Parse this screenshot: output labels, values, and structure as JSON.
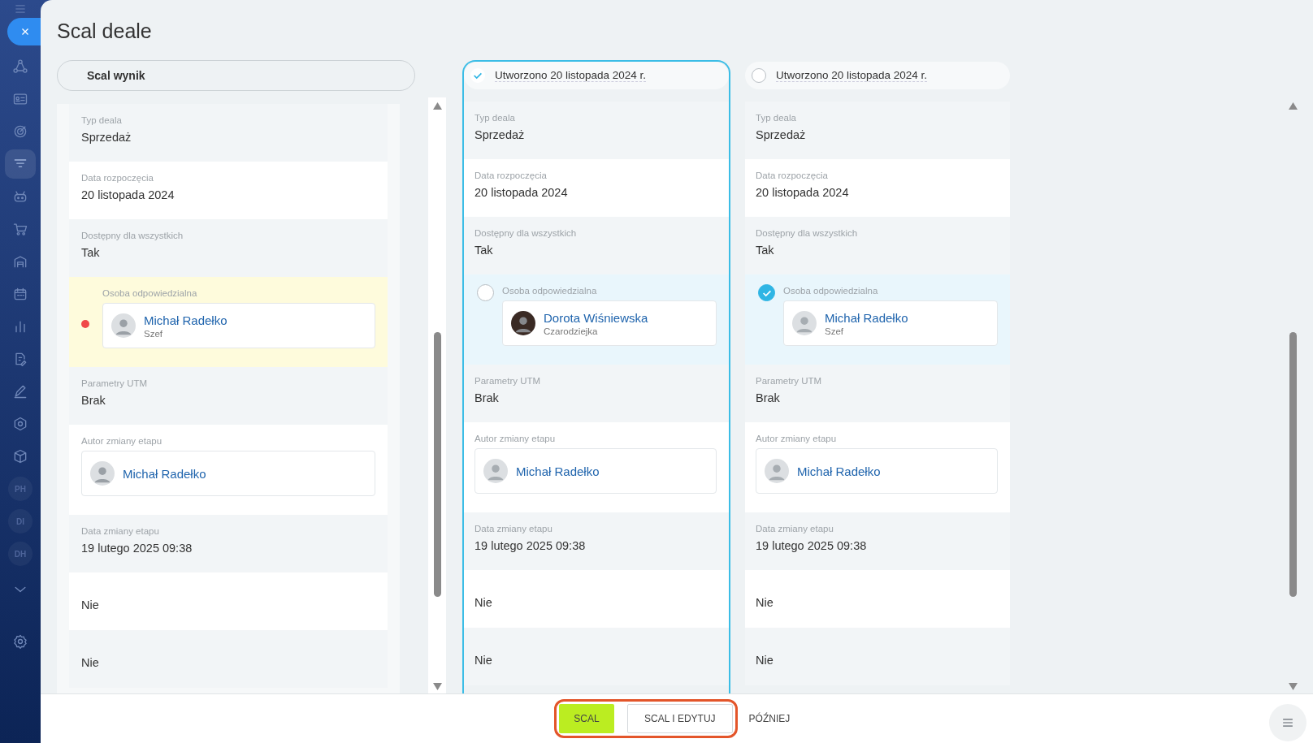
{
  "sidebar": {
    "icons": [
      {
        "selected": false
      },
      {
        "selected": false
      },
      {
        "selected": false
      },
      {
        "selected": true
      },
      {
        "selected": false
      },
      {
        "selected": false
      },
      {
        "selected": false
      },
      {
        "selected": false
      },
      {
        "selected": false
      },
      {
        "selected": false
      },
      {
        "selected": false
      },
      {
        "selected": false
      },
      {
        "selected": false
      }
    ],
    "initials": [
      "PH",
      "DI",
      "DH"
    ]
  },
  "title": "Scal deale",
  "result": {
    "title": "Scal wynik",
    "fields": [
      {
        "kind": "text",
        "label": "Typ deala",
        "value": "Sprzedaż"
      },
      {
        "kind": "text",
        "label": "Data rozpoczęcia",
        "value": "20 listopada 2024"
      },
      {
        "kind": "text",
        "label": "Dostępny dla wszystkich",
        "value": "Tak"
      },
      {
        "kind": "person",
        "label": "Osoba odpowiedzialna",
        "name": "Michał Radełko",
        "position": "Szef",
        "conflict": true
      },
      {
        "kind": "text",
        "label": "Parametry UTM",
        "value": "Brak"
      },
      {
        "kind": "person",
        "label": "Autor zmiany etapu",
        "name": "Michał Radełko",
        "conflict": false
      },
      {
        "kind": "text",
        "label": "Data zmiany etapu",
        "value": "19 lutego 2025 09:38"
      },
      {
        "kind": "text",
        "value": "Nie"
      },
      {
        "kind": "text",
        "value": "Nie"
      }
    ]
  },
  "sources": [
    {
      "title": "Utworzono 20 listopada 2024 r.",
      "selected": true,
      "fields": [
        {
          "kind": "text",
          "label": "Typ deala",
          "value": "Sprzedaż"
        },
        {
          "kind": "text",
          "label": "Data rozpoczęcia",
          "value": "20 listopada 2024"
        },
        {
          "kind": "text",
          "label": "Dostępny dla wszystkich",
          "value": "Tak"
        },
        {
          "kind": "person",
          "label": "Osoba odpowiedzialna",
          "name": "Dorota Wiśniewska",
          "position": "Czarodziejka",
          "color": "#3a2a24",
          "choice": {
            "selected": false
          }
        },
        {
          "kind": "text",
          "label": "Parametry UTM",
          "value": "Brak"
        },
        {
          "kind": "person",
          "label": "Autor zmiany etapu",
          "name": "Michał Radełko",
          "color": "#dcdfe2"
        },
        {
          "kind": "text",
          "label": "Data zmiany etapu",
          "value": "19 lutego 2025 09:38"
        },
        {
          "kind": "text",
          "value": "Nie"
        },
        {
          "kind": "text",
          "value": "Nie"
        }
      ]
    },
    {
      "title": "Utworzono 20 listopada 2024 r.",
      "selected": false,
      "fields": [
        {
          "kind": "text",
          "label": "Typ deala",
          "value": "Sprzedaż"
        },
        {
          "kind": "text",
          "label": "Data rozpoczęcia",
          "value": "20 listopada 2024"
        },
        {
          "kind": "text",
          "label": "Dostępny dla wszystkich",
          "value": "Tak"
        },
        {
          "kind": "person",
          "label": "Osoba odpowiedzialna",
          "name": "Michał Radełko",
          "position": "Szef",
          "color": "#dcdfe2",
          "choice": {
            "selected": true
          }
        },
        {
          "kind": "text",
          "label": "Parametry UTM",
          "value": "Brak"
        },
        {
          "kind": "person",
          "label": "Autor zmiany etapu",
          "name": "Michał Radełko",
          "color": "#dcdfe2"
        },
        {
          "kind": "text",
          "label": "Data zmiany etapu",
          "value": "19 lutego 2025 09:38"
        },
        {
          "kind": "text",
          "value": "Nie"
        },
        {
          "kind": "text",
          "value": "Nie"
        }
      ]
    }
  ],
  "footer": {
    "outlined": true,
    "buttons": [
      {
        "label": "SCAL",
        "kind": "primary"
      },
      {
        "label": "SCAL I EDYTUJ",
        "kind": "secondary"
      },
      {
        "label": "PÓŹNIEJ",
        "kind": "link"
      }
    ]
  }
}
